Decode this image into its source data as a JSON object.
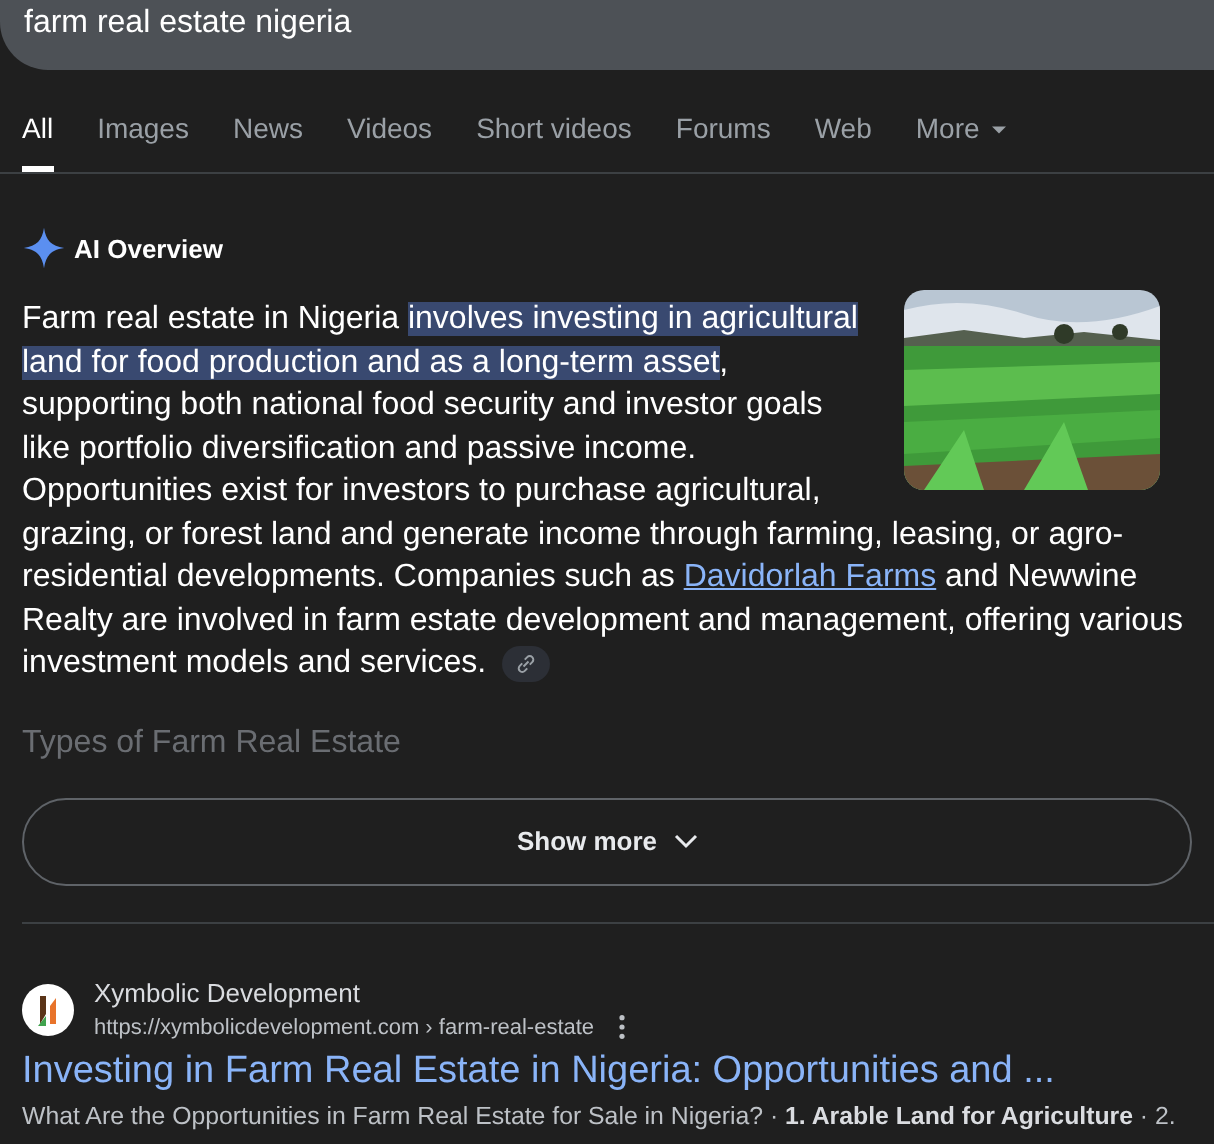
{
  "search": {
    "value": "farm real estate nigeria"
  },
  "tabs": [
    {
      "label": "All",
      "selected": true
    },
    {
      "label": "Images",
      "selected": false
    },
    {
      "label": "News",
      "selected": false
    },
    {
      "label": "Videos",
      "selected": false
    },
    {
      "label": "Short videos",
      "selected": false
    },
    {
      "label": "Forums",
      "selected": false
    },
    {
      "label": "Web",
      "selected": false
    },
    {
      "label": "More",
      "selected": false,
      "kind": "menu"
    }
  ],
  "ai_overview": {
    "title": "AI Overview",
    "paragraph": [
      {
        "kind": "plain",
        "text": "Farm real estate in Nigeria "
      },
      {
        "kind": "highlight",
        "text": "involves investing in agricultural land for food production and as a long-term asset"
      },
      {
        "kind": "plain",
        "text": ", supporting both national food security and investor goals like portfolio diversification and passive income. Opportunities exist for investors to purchase agricultural, grazing, or forest land and generate income through farming, leasing, or agro-residential developments. Companies such as "
      },
      {
        "kind": "link",
        "text": "Davidorlah Farms"
      },
      {
        "kind": "plain",
        "text": " and Newwine Realty are involved in farm estate development and management, offering various investment models and services."
      }
    ],
    "faded_heading": "Types of Farm Real Estate",
    "show_more": "Show more"
  },
  "results": [
    {
      "site": "Xymbolic Development",
      "url": "https://xymbolicdevelopment.com › farm-real-estate",
      "title": "Investing in Farm Real Estate in Nigeria: Opportunities and ...",
      "snippet": "What Are the Opportunities in Farm Real Estate for Sale in Nigeria? · **1. Arable Land for Agriculture** · 2."
    }
  ]
}
